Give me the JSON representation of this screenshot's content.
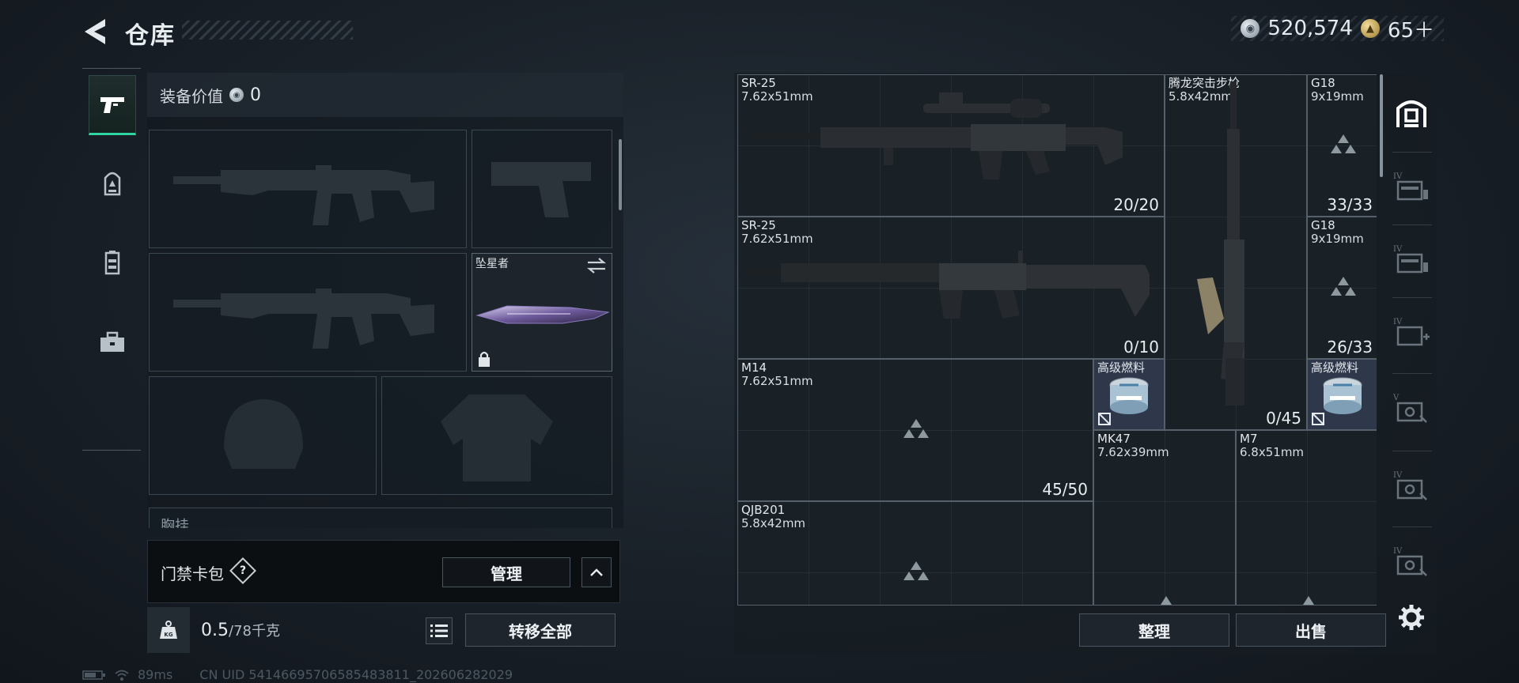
{
  "header": {
    "title": "仓库"
  },
  "currency": {
    "silver_value": "520,574",
    "gold_value": "65＋"
  },
  "equipment": {
    "value_label": "装备价值",
    "value": "0",
    "melee_name": "坠星者",
    "chest_label": "胸挂"
  },
  "access_card": {
    "label": "门禁卡包",
    "help": "?",
    "manage_label": "管理"
  },
  "weight": {
    "current": "0.5",
    "capacity": "/78千克"
  },
  "transfer_all_label": "转移全部",
  "stash": {
    "items": [
      {
        "name": "SR-25",
        "caliber": "7.62x51mm",
        "count": "20/20"
      },
      {
        "name": "腾龙突击步枪",
        "caliber": "5.8x42mm",
        "count": "0/45"
      },
      {
        "name": "G18",
        "caliber": "9x19mm",
        "count": "33/33"
      },
      {
        "name": "SR-25",
        "caliber": "7.62x51mm",
        "count": "0/10"
      },
      {
        "name": "G18",
        "caliber": "9x19mm",
        "count": "26/33"
      },
      {
        "name": "M14",
        "caliber": "7.62x51mm",
        "count": "45/50"
      },
      {
        "name": "高级燃料",
        "caliber": "",
        "count": ""
      },
      {
        "name": "高级燃料",
        "caliber": "",
        "count": ""
      },
      {
        "name": "MK47",
        "caliber": "7.62x39mm",
        "count": ""
      },
      {
        "name": "M7",
        "caliber": "6.8x51mm",
        "count": ""
      },
      {
        "name": "QJB201",
        "caliber": "5.8x42mm",
        "count": ""
      }
    ],
    "sort_label": "整理",
    "sell_label": "出售"
  },
  "side_tabs": [
    "IV",
    "IV",
    "IV",
    "V",
    "IV",
    "IV"
  ],
  "status": {
    "ping": "89ms",
    "uid": "CN UID 54146695706585483811_202606282029"
  },
  "colors": {
    "accent": "#2fd4a0",
    "panel": "#161c22",
    "border": "#55606a"
  }
}
